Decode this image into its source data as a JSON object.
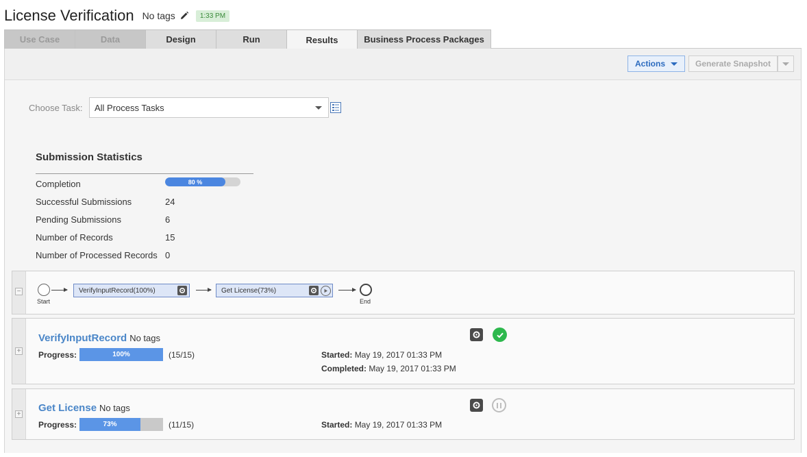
{
  "header": {
    "title": "License Verification",
    "tags": "No tags",
    "time_badge": "1:33 PM"
  },
  "tabs": [
    {
      "label": "Use Case",
      "state": "disabled"
    },
    {
      "label": "Data",
      "state": "disabled"
    },
    {
      "label": "Design",
      "state": "normal"
    },
    {
      "label": "Run",
      "state": "normal"
    },
    {
      "label": "Results",
      "state": "active"
    },
    {
      "label": "Business Process Packages",
      "state": "normal"
    }
  ],
  "toolbar": {
    "actions_label": "Actions",
    "snapshot_label": "Generate Snapshot"
  },
  "task_chooser": {
    "label": "Choose Task:",
    "selected": "All Process Tasks"
  },
  "stats": {
    "title": "Submission Statistics",
    "completion_label": "Completion",
    "completion_value": "80 %",
    "completion_fraction": 0.8,
    "rows": [
      {
        "label": "Successful Submissions",
        "value": "24"
      },
      {
        "label": "Pending Submissions",
        "value": "6"
      },
      {
        "label": "Number of Records",
        "value": "15"
      },
      {
        "label": "Number of Processed Records",
        "value": "0"
      }
    ]
  },
  "flow": {
    "start_label": "Start",
    "end_label": "End",
    "nodes": [
      {
        "label": "VerifyInputRecord(100%)"
      },
      {
        "label": "Get License(73%)"
      }
    ]
  },
  "tasks": [
    {
      "name": "VerifyInputRecord",
      "tags": "No tags",
      "progress_label": "Progress:",
      "progress_text": "100%",
      "progress_fraction": 1.0,
      "count": "(15/15)",
      "started_label": "Started:",
      "started_value": "May 19, 2017 01:33 PM",
      "completed_label": "Completed:",
      "completed_value": "May 19, 2017 01:33 PM",
      "status_icon": "check-circle-icon"
    },
    {
      "name": "Get License",
      "tags": "No tags",
      "progress_label": "Progress:",
      "progress_text": "73%",
      "progress_fraction": 0.73,
      "count": "(11/15)",
      "started_label": "Started:",
      "started_value": "May 19, 2017 01:33 PM",
      "status_icon": "pause-circle-icon"
    }
  ],
  "colors": {
    "accent": "#4a86c8",
    "progress": "#5b95e6",
    "success": "#2db84d"
  }
}
